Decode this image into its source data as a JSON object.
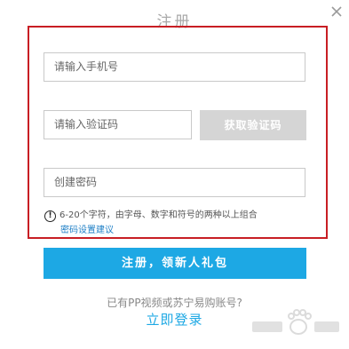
{
  "dialog": {
    "title": "注册",
    "close_icon": "close-icon"
  },
  "form": {
    "phone_placeholder": "请输入手机号",
    "code_placeholder": "请输入验证码",
    "get_code_label": "获取验证码",
    "password_placeholder": "创建密码",
    "hint_icon_glyph": "!",
    "hint_text": "6-20个字符，由字母、数字和符号的两种以上组合",
    "suggest_link": "密码设置建议"
  },
  "actions": {
    "register_label": "注册，领新人礼包",
    "have_account_text": "已有PP视频或苏宁易购账号?",
    "login_label": "立即登录"
  },
  "colors": {
    "highlight_border": "#c81e24",
    "primary": "#1da8e4",
    "disabled_button": "#d5d5d5",
    "link": "#1e7fc6"
  },
  "watermark": {
    "name": "baidu-jingyan-watermark"
  }
}
